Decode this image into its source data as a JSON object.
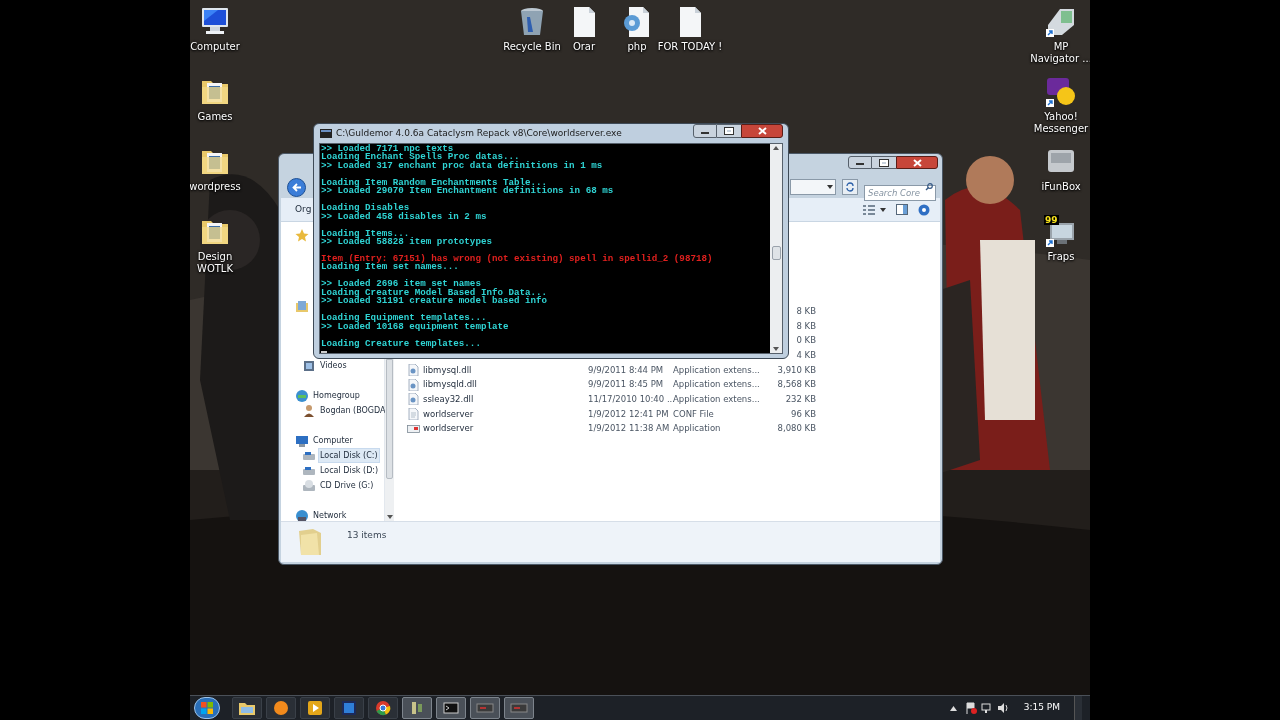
{
  "desktop": {
    "left_icons": [
      {
        "kind": "computer",
        "label": "Computer"
      },
      {
        "kind": "folder",
        "label": "Games"
      },
      {
        "kind": "folder",
        "label": "wordpress"
      },
      {
        "kind": "folder",
        "label": "Design WOTLK"
      }
    ],
    "top_icons": [
      {
        "kind": "recycle-bin",
        "label": "Recycle Bin"
      },
      {
        "kind": "document",
        "label": "Orar"
      },
      {
        "kind": "php",
        "label": "php"
      },
      {
        "kind": "document",
        "label": "FOR TODAY !"
      }
    ],
    "right_icons": [
      {
        "kind": "scanner",
        "label": "MP Navigator ...",
        "shortcut": true
      },
      {
        "kind": "messenger",
        "label": "Yahoo! Messenger",
        "shortcut": true
      },
      {
        "kind": "drive",
        "label": "iFunBox",
        "shortcut": false
      },
      {
        "kind": "fraps",
        "label": "Fraps",
        "shortcut": true,
        "badge": "99"
      }
    ]
  },
  "explorer": {
    "search": {
      "placeholder": "Search Core"
    },
    "toolbar": {
      "organize": "Org"
    },
    "nav": [
      {
        "kind": "favorites"
      },
      {
        "kind": "libraries",
        "children": [
          {
            "kind": "videos",
            "label": "Videos",
            "selected": false
          }
        ]
      },
      {
        "kind": "homegroup",
        "label": "Homegroup",
        "selected": false,
        "children": [
          {
            "kind": "user",
            "label": "Bogdan (BOGDA",
            "selected": false
          }
        ]
      },
      {
        "kind": "computer",
        "label": "Computer",
        "selected": false,
        "children": [
          {
            "kind": "disk",
            "label": "Local Disk (C:)",
            "selected": true
          },
          {
            "kind": "disk",
            "label": "Local Disk (D:)",
            "selected": false
          },
          {
            "kind": "cd",
            "label": "CD Drive (G:)",
            "selected": false
          }
        ]
      },
      {
        "kind": "network",
        "label": "Network",
        "selected": false
      }
    ],
    "files": [
      {
        "size": "8 KB"
      },
      {
        "size": "8 KB"
      },
      {
        "size": "0 KB"
      },
      {
        "size": "4 KB"
      },
      {
        "kind": "dll",
        "name": "libmysql.dll",
        "date": "9/9/2011 8:44 PM",
        "type": "Application extens...",
        "size": "3,910 KB"
      },
      {
        "kind": "dll",
        "name": "libmysqld.dll",
        "date": "9/9/2011 8:45 PM",
        "type": "Application extens...",
        "size": "8,568 KB"
      },
      {
        "kind": "dll",
        "name": "ssleay32.dll",
        "date": "11/17/2010 10:40 ...",
        "type": "Application extens...",
        "size": "232 KB"
      },
      {
        "kind": "conf",
        "name": "worldserver",
        "date": "1/9/2012 12:41 PM",
        "type": "CONF File",
        "size": "96 KB"
      },
      {
        "kind": "exe",
        "name": "worldserver",
        "date": "1/9/2012 11:38 AM",
        "type": "Application",
        "size": "8,080 KB"
      }
    ],
    "status": "13 items"
  },
  "console": {
    "title": "C:\\Guldemor 4.0.6a Cataclysm Repack v8\\Core\\worldserver.exe",
    "lines": [
      {
        "kind": "info",
        "text": ">> Loaded 7171 npc texts"
      },
      {
        "kind": "info",
        "text": "Loading Enchant Spells Proc datas..."
      },
      {
        "kind": "info",
        "text": ">> Loaded 317 enchant proc data definitions in 1 ms"
      },
      {
        "kind": "blank"
      },
      {
        "kind": "info",
        "text": "Loading Item Random Enchantments Table..."
      },
      {
        "kind": "info",
        "text": ">> Loaded 29070 Item Enchantment definitions in 68 ms"
      },
      {
        "kind": "blank"
      },
      {
        "kind": "info",
        "text": "Loading Disables"
      },
      {
        "kind": "info",
        "text": ">> Loaded 458 disables in 2 ms"
      },
      {
        "kind": "blank"
      },
      {
        "kind": "info",
        "text": "Loading Items..."
      },
      {
        "kind": "info",
        "text": ">> Loaded 58828 item prototypes"
      },
      {
        "kind": "blank"
      },
      {
        "kind": "error",
        "text": "Item (Entry: 67151) has wrong (not existing) spell in spellid_2 (98718)"
      },
      {
        "kind": "info",
        "text": "Loading Item set names..."
      },
      {
        "kind": "blank"
      },
      {
        "kind": "info",
        "text": ">> Loaded 2696 item set names"
      },
      {
        "kind": "info",
        "text": "Loading Creature Model Based Info Data..."
      },
      {
        "kind": "info",
        "text": ">> Loaded 31191 creature model based info"
      },
      {
        "kind": "blank"
      },
      {
        "kind": "info",
        "text": "Loading Equipment templates..."
      },
      {
        "kind": "info",
        "text": ">> Loaded 10168 equipment template"
      },
      {
        "kind": "blank"
      },
      {
        "kind": "info",
        "text": "Loading Creature templates..."
      }
    ]
  },
  "taskbar": {
    "items": [
      {
        "kind": "explorer",
        "open": false
      },
      {
        "kind": "player",
        "open": false
      },
      {
        "kind": "media",
        "open": false
      },
      {
        "kind": "photoshop",
        "open": false
      },
      {
        "kind": "chrome",
        "open": false
      },
      {
        "kind": "tool",
        "open": true
      },
      {
        "kind": "console",
        "open": true
      },
      {
        "kind": "window",
        "open": true
      },
      {
        "kind": "window",
        "open": true
      }
    ],
    "clock": "3:15 PM"
  }
}
